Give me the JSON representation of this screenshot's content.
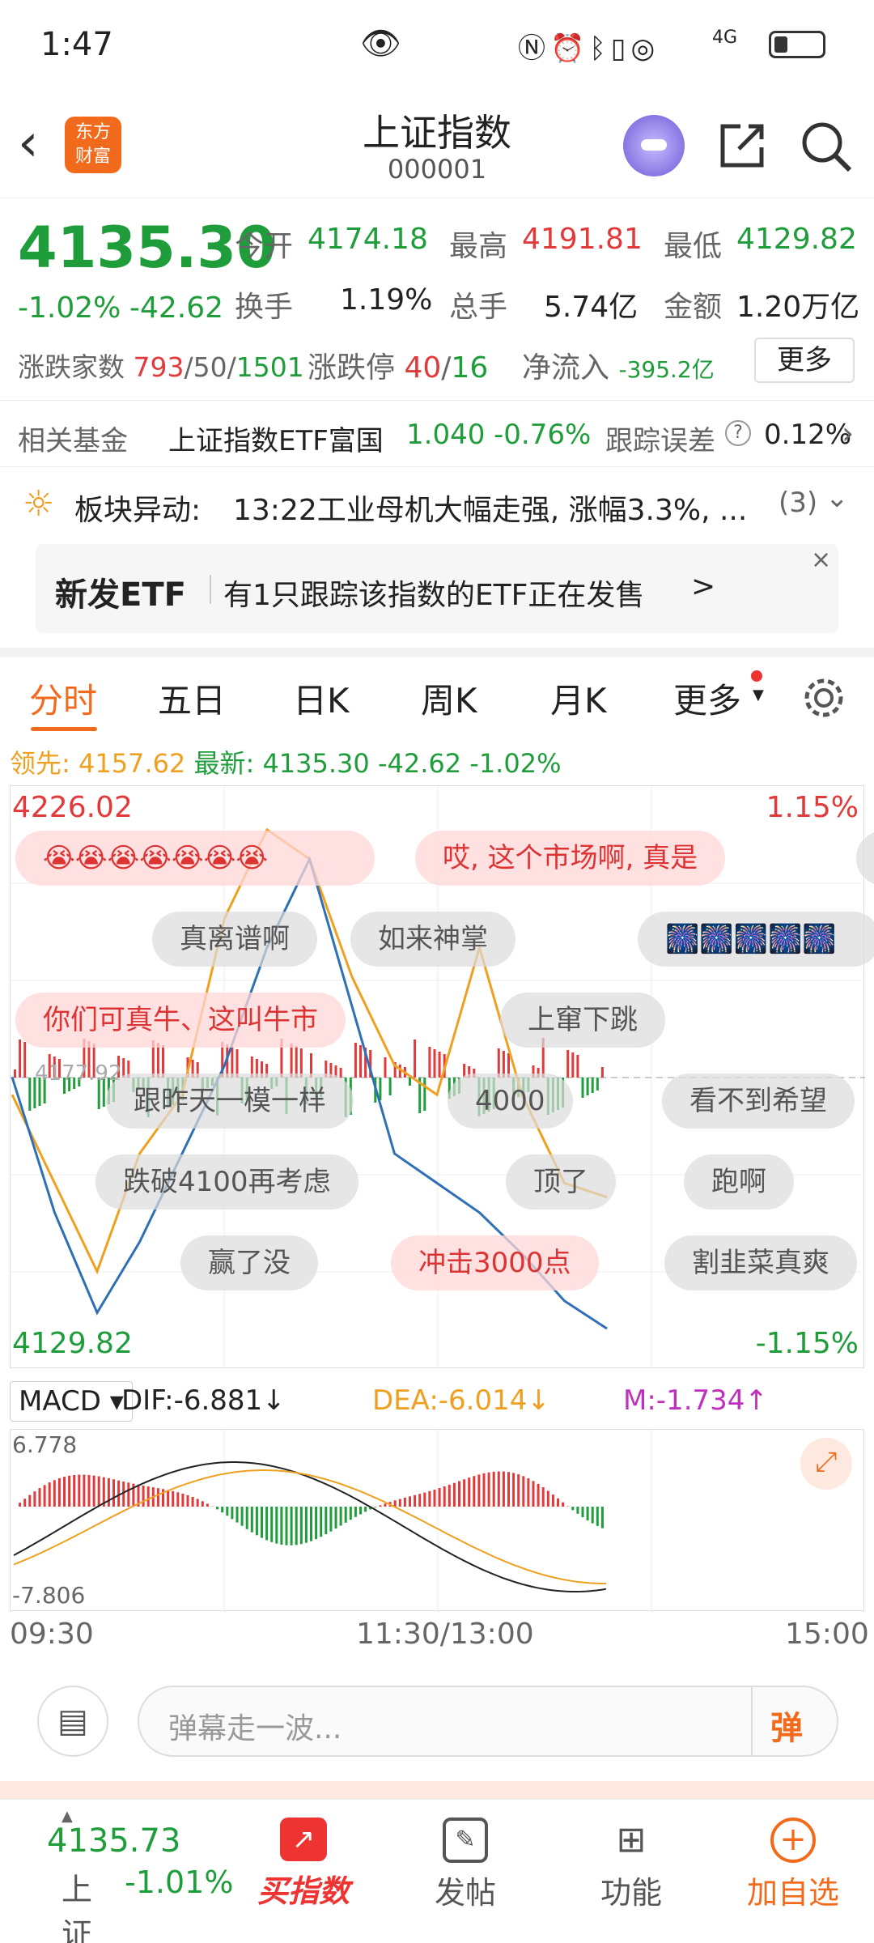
{
  "status": {
    "time": "1:47",
    "network": "4G"
  },
  "header": {
    "title": "上证指数",
    "code": "000001",
    "logo_line1": "东方",
    "logo_line2": "财富"
  },
  "quote": {
    "price": "4135.30",
    "change_pct": "-1.02%",
    "change": "-42.62",
    "open_label": "今开",
    "open": "4174.18",
    "high_label": "最高",
    "high": "4191.81",
    "low_label": "最低",
    "low": "4129.82",
    "turnover_label": "换手",
    "turnover": "1.19%",
    "volume_label": "总手",
    "volume": "5.74亿",
    "amount_label": "金额",
    "amount": "1.20万亿",
    "breadth_label": "涨跌家数",
    "breadth_up": "793",
    "breadth_flat": "/50/",
    "breadth_down": "1501",
    "limit_label": "涨跌停",
    "limit_up": "40",
    "limit_sep": "/",
    "limit_down": "16",
    "inflow_label": "净流入",
    "inflow": "-395.2亿",
    "more_button": "更多"
  },
  "fund": {
    "label": "相关基金",
    "name": "上证指数ETF富国",
    "price": "1.040",
    "change": "-0.76%",
    "error_label": "跟踪误差",
    "error_value": "0.12%"
  },
  "alert": {
    "label": "板块异动:",
    "text": "13:22工业母机大幅走强, 涨幅3.3%, ...",
    "count": "(3)"
  },
  "etf_banner": {
    "tag": "新发ETF",
    "text": "有1只跟踪该指数的ETF正在发售",
    "arrow": ">"
  },
  "tabs": [
    "分时",
    "五日",
    "日K",
    "周K",
    "月K",
    "更多"
  ],
  "chart_header": {
    "lead_label": "领先:",
    "lead": "4157.62",
    "latest_label": "最新:",
    "latest": "4135.30",
    "change": "-42.62",
    "pct": "-1.02%"
  },
  "chart_labels": {
    "max": "4226.02",
    "min": "4129.82",
    "max_pct": "1.15%",
    "min_pct": "-1.15%",
    "prev_close": "4177.92"
  },
  "danmu": [
    "哎, 这个市场啊, 真是",
    "真离谱啊",
    "如来神掌",
    "你们可真牛、这叫牛市",
    "上窜下跳",
    "跟昨天一模一样",
    "4000",
    "看不到希望",
    "跌破4100再考虑",
    "顶了",
    "跑啊",
    "赢了没",
    "冲击3000点",
    "割韭菜真爽"
  ],
  "macd": {
    "selector": "MACD",
    "dif": "DIF:-6.881↓",
    "dea": "DEA:-6.014↓",
    "m": "M:-1.734↑",
    "max": "6.778",
    "min": "-7.806"
  },
  "time_axis": {
    "start": "09:30",
    "mid": "11:30/13:00",
    "end": "15:00"
  },
  "comment": {
    "placeholder": "弹幕走一波...",
    "send": "弹"
  },
  "bottom_nav": {
    "index_price": "4135.73",
    "index_name": "上证",
    "index_pct": "-1.01%",
    "buy": "买指数",
    "post": "发帖",
    "func": "功能",
    "add": "加自选"
  },
  "chart_data": {
    "type": "line",
    "title": "",
    "ylim": [
      4129.82,
      4226.02
    ],
    "x": [
      "09:30",
      "11:30/13:00",
      "15:00"
    ],
    "series": [
      {
        "name": "最新",
        "values": [
          4178,
          4155,
          4138,
          4150,
          4165,
          4180,
          4200,
          4215,
          4190,
          4165,
          4160,
          4155,
          4148,
          4140,
          4135.3
        ]
      },
      {
        "name": "领先",
        "values": [
          4175,
          4160,
          4145,
          4165,
          4175,
          4205,
          4220,
          4215,
          4195,
          4180,
          4175,
          4200,
          4175,
          4160,
          4157.62
        ]
      }
    ]
  },
  "colors": {
    "up": "#e23a3a",
    "down": "#1f9d3a",
    "brand": "#f26b1d",
    "price_line": "#2f6fb5",
    "avg_line": "#f0a020"
  }
}
